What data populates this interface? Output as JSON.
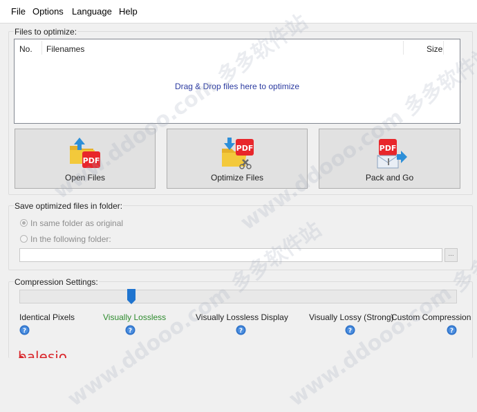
{
  "menu": {
    "items": [
      "File",
      "Options",
      "Language",
      "Help"
    ]
  },
  "files": {
    "group_label": "Files to optimize:",
    "columns": {
      "no": "No.",
      "filenames": "Filenames",
      "size": "Size"
    },
    "drop_hint": "Drag & Drop files here to optimize"
  },
  "actions": {
    "open_label": "Open Files",
    "optimize_label": "Optimize Files",
    "pack_label": "Pack and Go"
  },
  "save": {
    "group_label": "Save optimized files in folder:",
    "option_same": "In same folder as original",
    "option_following": "In the following folder:",
    "folder_value": "",
    "browse_label": "..."
  },
  "compression": {
    "group_label": "Compression Settings:",
    "levels": [
      "Identical Pixels",
      "Visually Lossless",
      "Visually Lossless Display",
      "Visually Lossy (Strong)",
      "Custom Compression"
    ],
    "selected_index": 1,
    "selected_color": "#2e8b2e"
  },
  "watermark": "www.ddooo.com 多多软件站",
  "logo_text": "balesio",
  "colors": {
    "accent_blue": "#2b3aa0",
    "pdf_red": "#e8262b",
    "folder_yellow": "#f3c93b"
  }
}
